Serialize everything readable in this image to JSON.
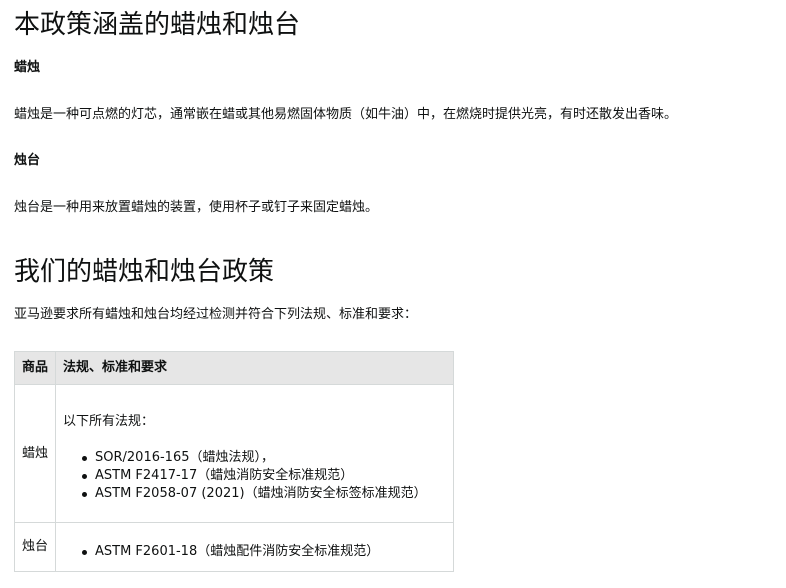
{
  "sections": {
    "coverage": {
      "heading": "本政策涵盖的蜡烛和烛台",
      "candle": {
        "term": "蜡烛",
        "definition": "蜡烛是一种可点燃的灯芯，通常嵌在蜡或其他易燃固体物质（如牛油）中，在燃烧时提供光亮，有时还散发出香味。"
      },
      "holder": {
        "term": "烛台",
        "definition": "烛台是一种用来放置蜡烛的装置，使用杯子或钉子来固定蜡烛。"
      }
    },
    "policy": {
      "heading": "我们的蜡烛和烛台政策",
      "intro": "亚马逊要求所有蜡烛和烛台均经过检测并符合下列法规、标准和要求："
    }
  },
  "table": {
    "headers": {
      "item": "商品",
      "regulations": "法规、标准和要求"
    },
    "rows": [
      {
        "item": "蜡烛",
        "intro": "以下所有法规：",
        "regulations": [
          "SOR/2016-165（蜡烛法规），",
          "ASTM F2417-17（蜡烛消防安全标准规范）",
          "ASTM F2058-07 (2021)（蜡烛消防安全标签标准规范）"
        ]
      },
      {
        "item": "烛台",
        "regulations": [
          "ASTM F2601-18（蜡烛配件消防安全标准规范）"
        ]
      }
    ]
  }
}
